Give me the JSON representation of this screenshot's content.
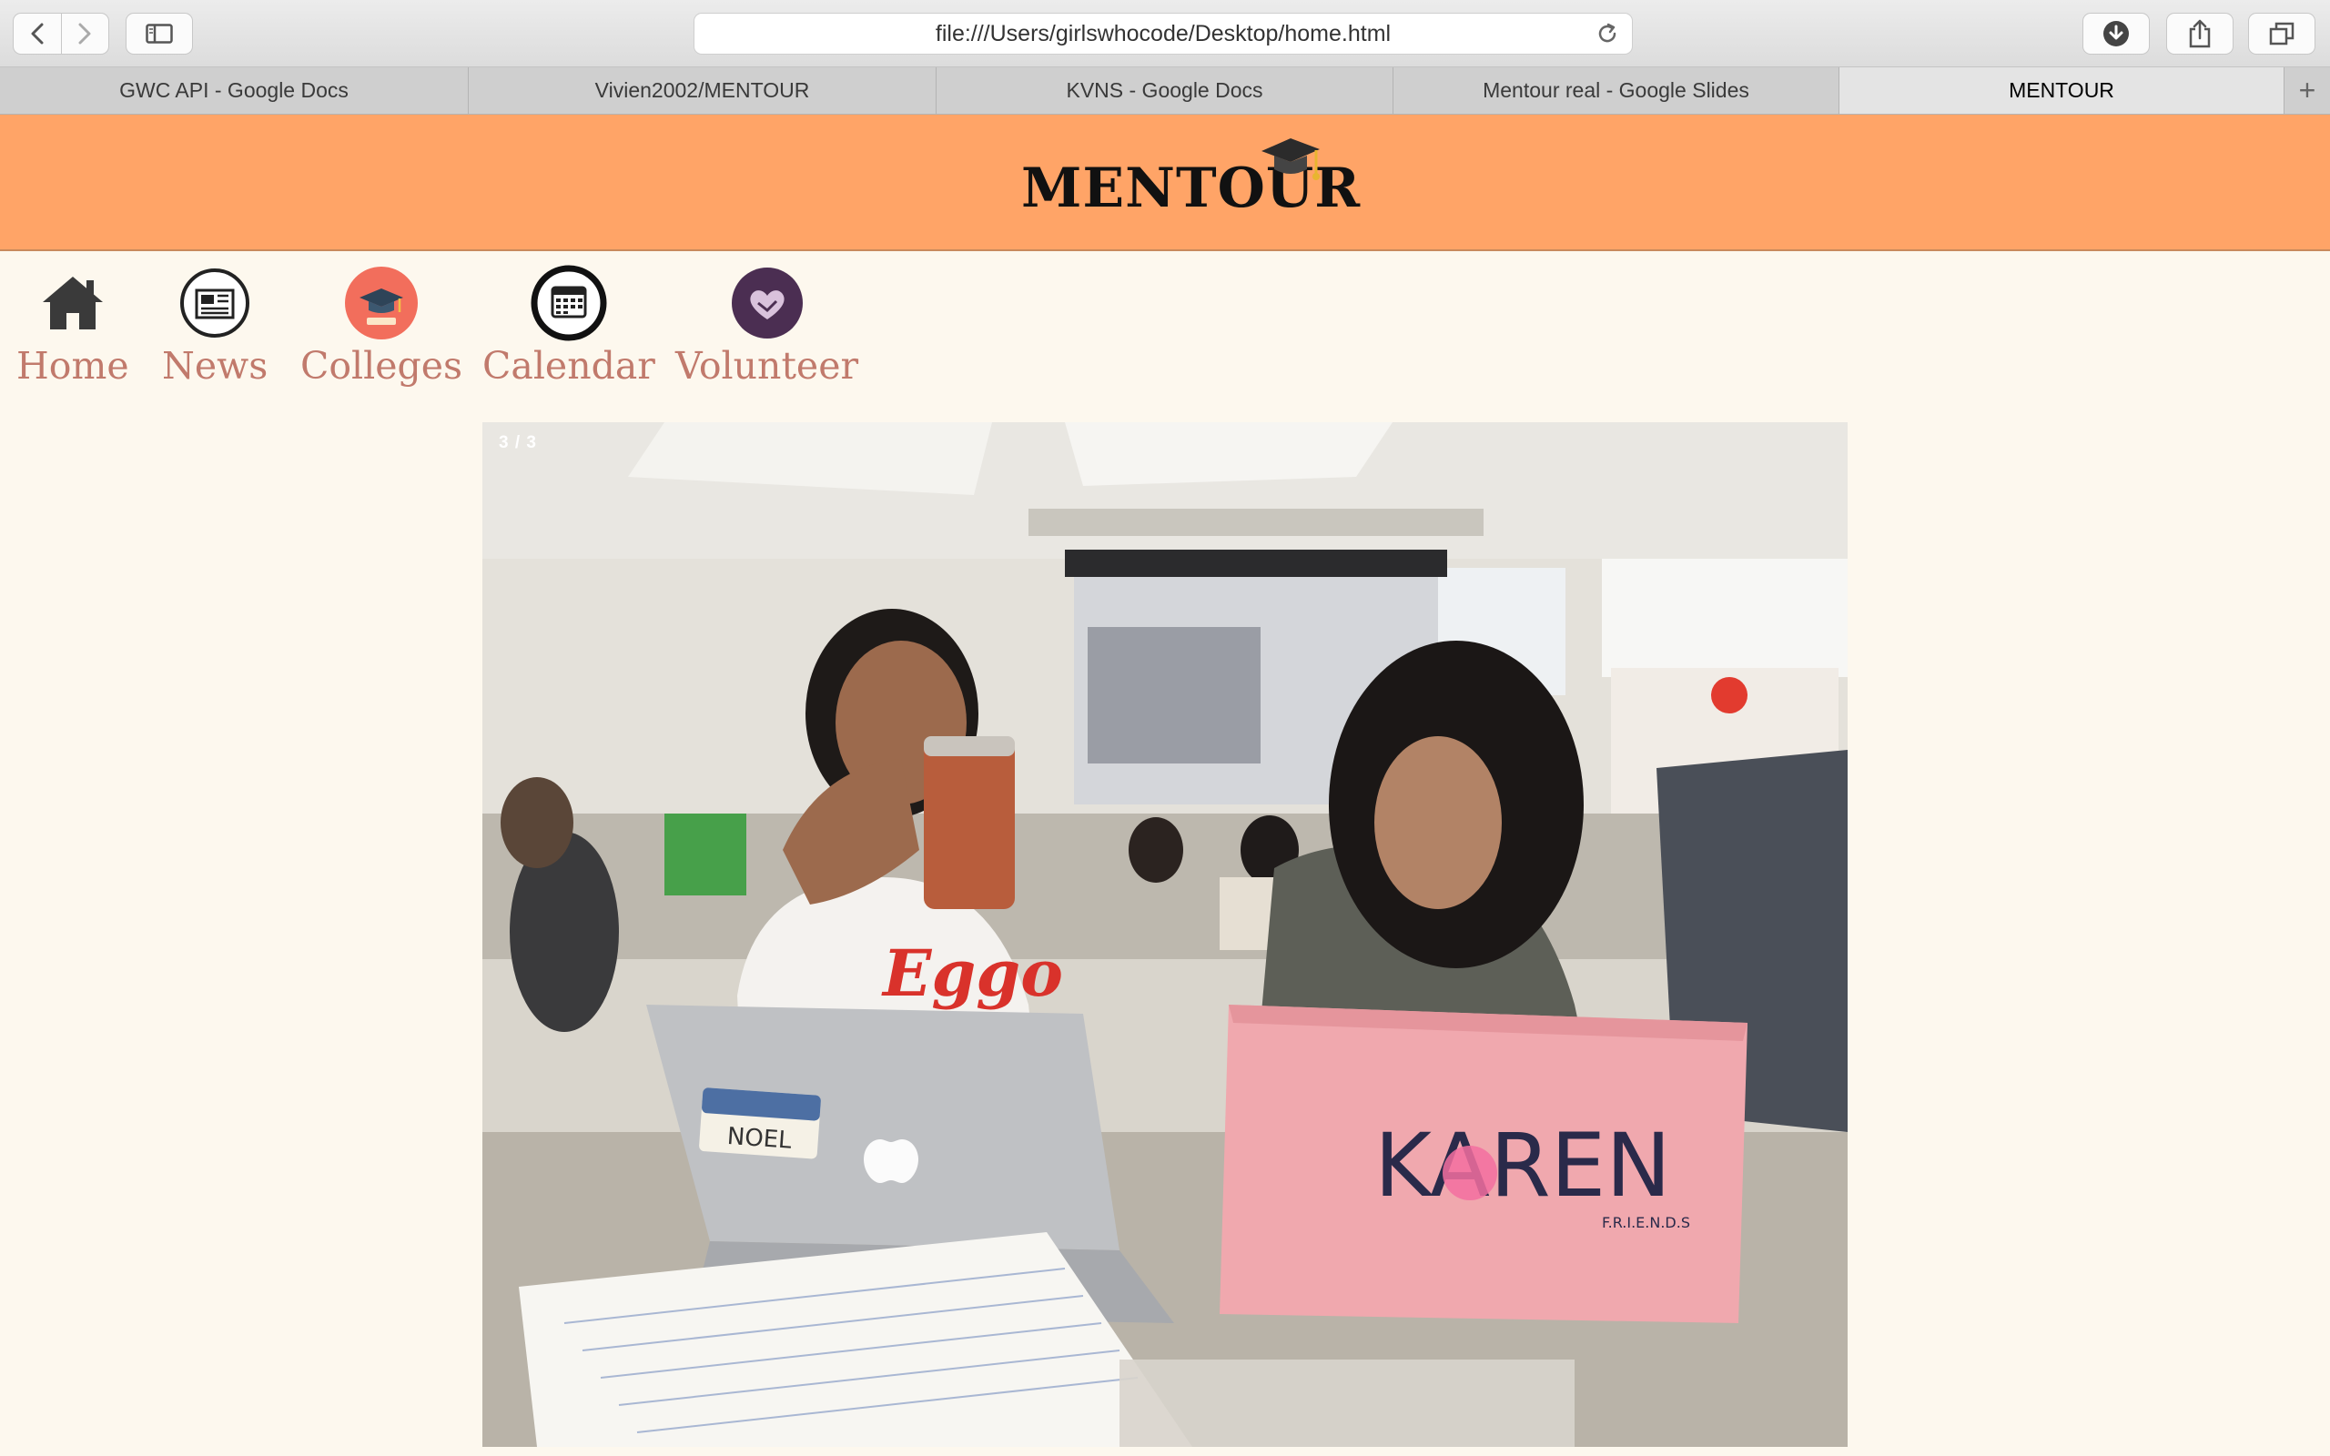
{
  "browser": {
    "url": "file:///Users/girlswhocode/Desktop/home.html",
    "tabs": [
      {
        "label": "GWC API - Google Docs",
        "active": false
      },
      {
        "label": "Vivien2002/MENTOUR",
        "active": false
      },
      {
        "label": "KVNS - Google Docs",
        "active": false
      },
      {
        "label": "Mentour real - Google Slides",
        "active": false
      },
      {
        "label": "MENTOUR",
        "active": true
      }
    ],
    "icons": [
      "back-icon",
      "forward-icon",
      "sidebar-icon",
      "reload-icon",
      "download-icon",
      "share-icon",
      "tabs-overview-icon",
      "new-tab-icon"
    ]
  },
  "site": {
    "logo": "MENTOUR",
    "colors": {
      "header": "#ffa467",
      "background": "#fdf8ee",
      "nav_text": "#c17a6c"
    },
    "nav": [
      {
        "label": "Home",
        "icon": "home-icon"
      },
      {
        "label": "News",
        "icon": "newspaper-icon"
      },
      {
        "label": "Colleges",
        "icon": "graduation-cap-icon"
      },
      {
        "label": "Calendar",
        "icon": "calendar-icon"
      },
      {
        "label": "Volunteer",
        "icon": "heart-hands-icon"
      }
    ]
  },
  "slideshow": {
    "counter": "3 / 3",
    "photo_text": {
      "laptop_sticker": "NOEL",
      "laptop_name": "KAREN",
      "sticker_friends": "F.R.I.E.N.D.S",
      "shirt": "Eggo"
    }
  }
}
